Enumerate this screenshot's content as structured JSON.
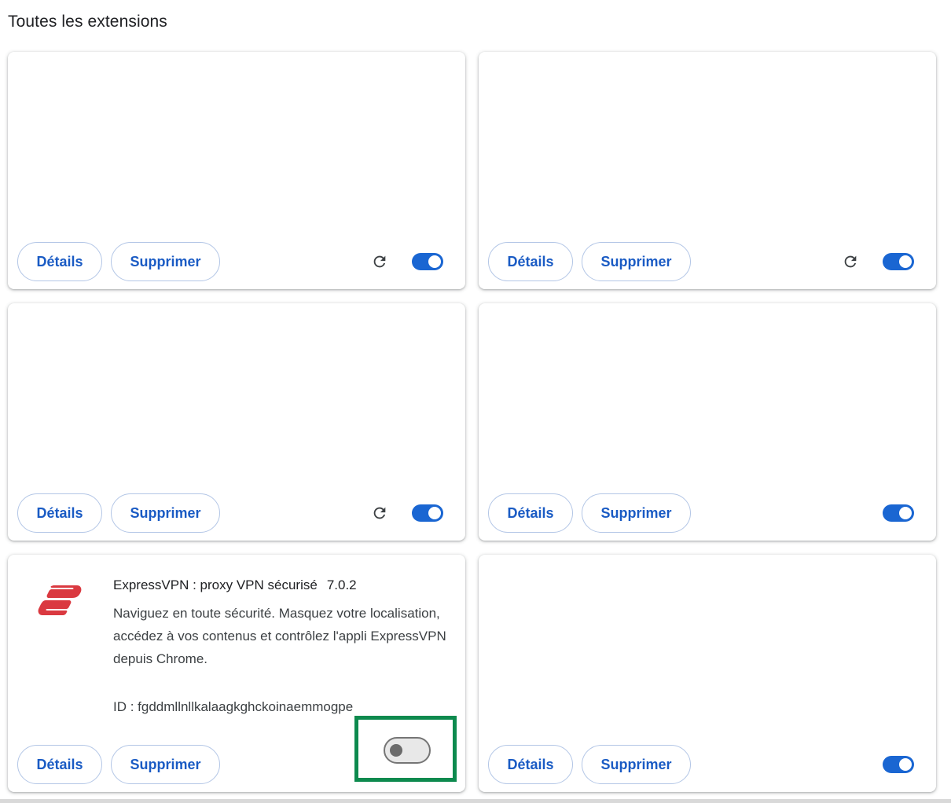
{
  "section": {
    "title": "Toutes les extensions"
  },
  "buttons": {
    "details_label": "Détails",
    "remove_label": "Supprimer"
  },
  "cards": [
    {
      "has_reload": true,
      "enabled": true
    },
    {
      "has_reload": true,
      "enabled": true
    },
    {
      "has_reload": true,
      "enabled": true
    },
    {
      "has_reload": false,
      "enabled": true
    },
    {
      "has_reload": false,
      "enabled": false,
      "name": "ExpressVPN : proxy VPN sécurisé",
      "version": "7.0.2",
      "description": "Naviguez en toute sécurité. Masquez votre localisation, accédez à vos contenus et contrôlez l'appli ExpressVPN depuis Chrome.",
      "id_text": "ID : fgddmllnllkalaagkghckoinaemmogpe",
      "icon": "expressvpn-logo",
      "highlighted_control": "toggle"
    },
    {
      "has_reload": false,
      "enabled": true
    }
  ],
  "colors": {
    "accent": "#1a66d2",
    "button_text": "#1a5bc4",
    "highlight": "#0d8a4e",
    "logo": "#da3940"
  },
  "icons": {
    "reload": "reload-icon",
    "toggle_on": "toggle-on",
    "toggle_off": "toggle-off"
  }
}
